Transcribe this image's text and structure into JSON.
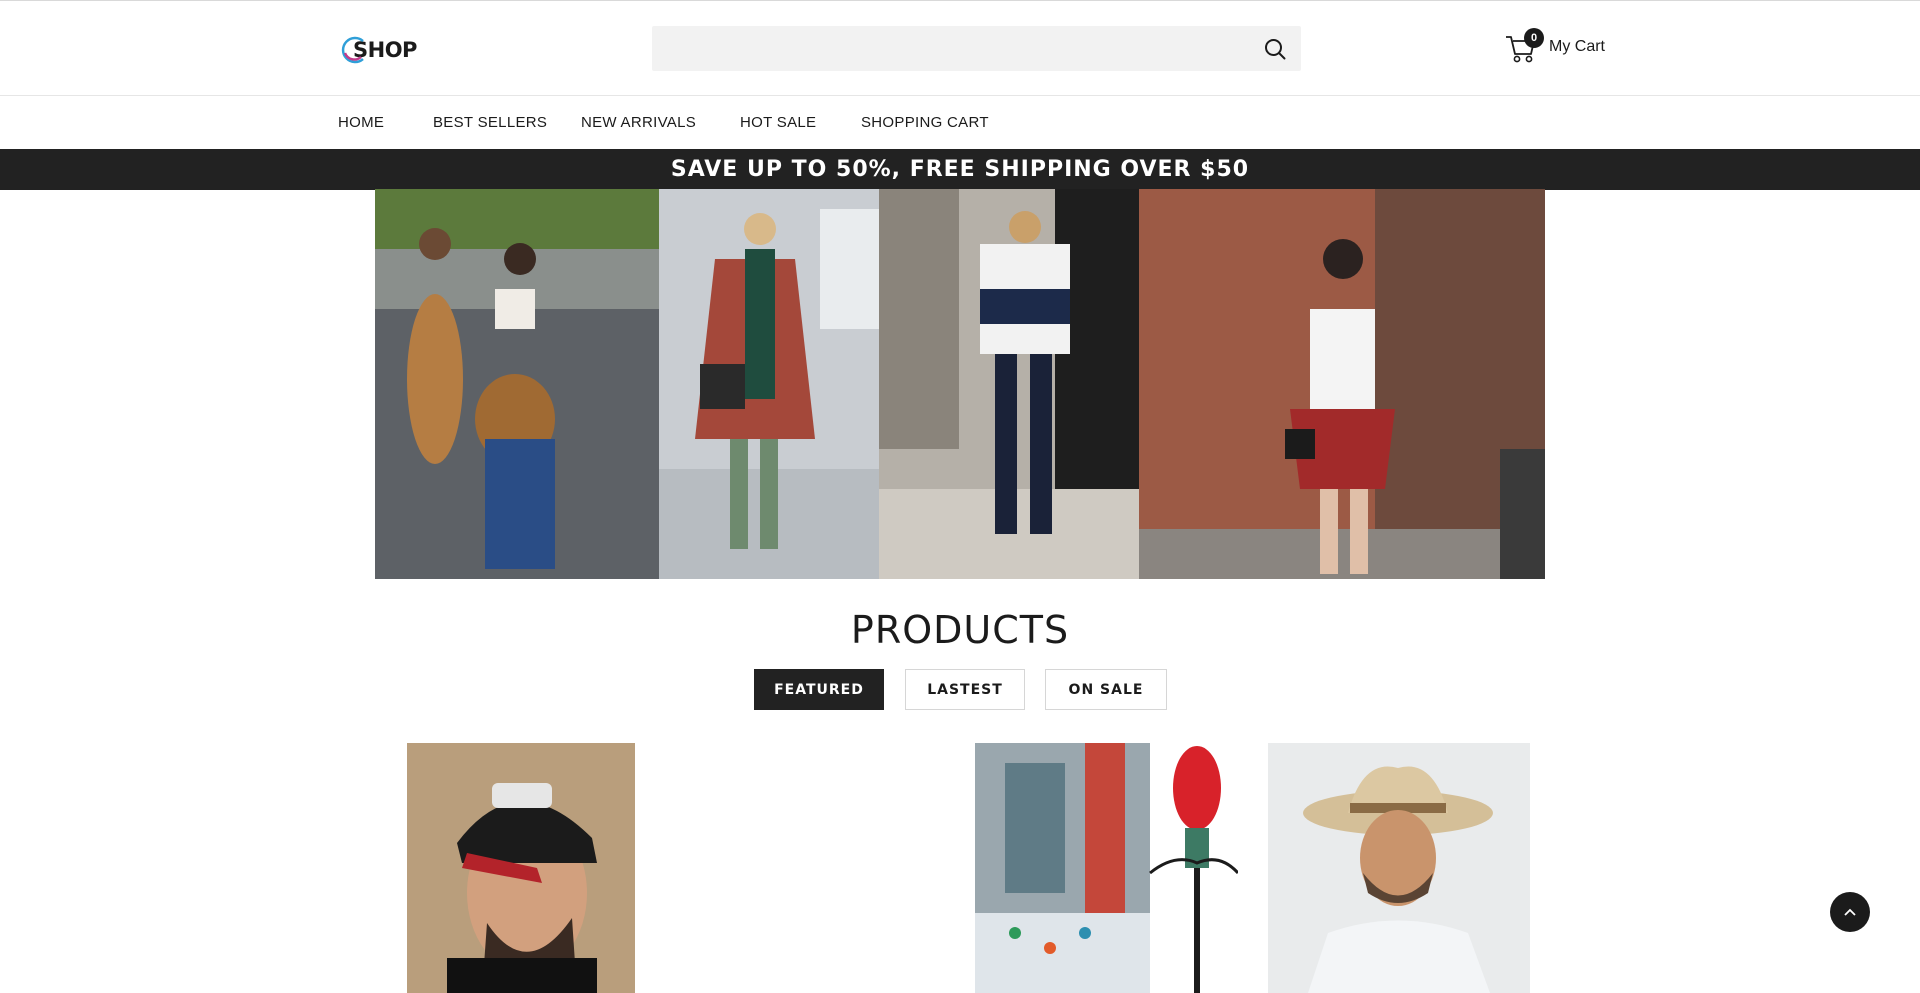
{
  "header": {
    "logo_text": "SHOP",
    "search": {
      "value": "",
      "placeholder": ""
    },
    "cart": {
      "count": "0",
      "label": "My Cart"
    }
  },
  "nav": {
    "items": [
      {
        "label": "HOME"
      },
      {
        "label": "BEST SELLERS"
      },
      {
        "label": "NEW ARRIVALS"
      },
      {
        "label": "HOT SALE"
      },
      {
        "label": "SHOPPING CART"
      }
    ]
  },
  "promo": {
    "text": "SAVE UP TO 50%, FREE SHIPPING OVER $50"
  },
  "products": {
    "title": "PRODUCTS",
    "tabs": [
      {
        "label": "FEATURED",
        "active": true
      },
      {
        "label": "LASTEST",
        "active": false
      },
      {
        "label": "ON SALE",
        "active": false
      }
    ]
  },
  "icons": {
    "search": "search-icon",
    "cart": "cart-icon",
    "back_to_top": "chevron-up-icon"
  },
  "colors": {
    "promo_bar": "#222222",
    "active_tab": "#222222",
    "search_bg": "#f2f2f2"
  }
}
